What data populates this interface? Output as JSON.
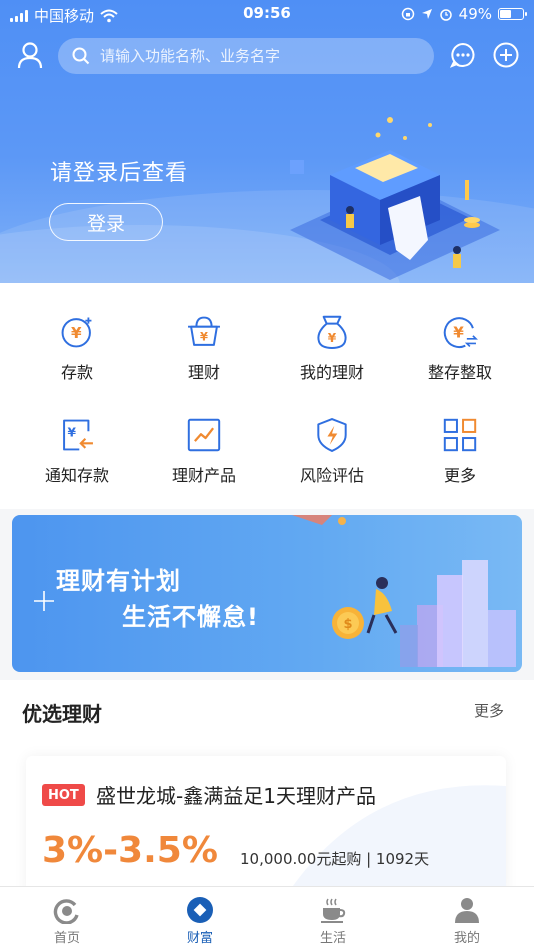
{
  "status_bar": {
    "carrier": "中国移动",
    "time": "09:56",
    "battery": "49%"
  },
  "search": {
    "placeholder": "请输入功能名称、业务名字"
  },
  "hero": {
    "prompt": "请登录后查看",
    "login_label": "登录"
  },
  "grid": [
    {
      "label": "存款",
      "icon": "deposit-icon"
    },
    {
      "label": "理财",
      "icon": "wealth-basket-icon"
    },
    {
      "label": "我的理财",
      "icon": "money-bag-icon"
    },
    {
      "label": "整存整取",
      "icon": "lump-sum-icon"
    },
    {
      "label": "通知存款",
      "icon": "notice-deposit-icon"
    },
    {
      "label": "理财产品",
      "icon": "chart-trend-icon"
    },
    {
      "label": "风险评估",
      "icon": "shield-bolt-icon"
    },
    {
      "label": "更多",
      "icon": "grid-more-icon"
    }
  ],
  "banner": {
    "line1": "理财有计划",
    "line2": "生活不懈怠!"
  },
  "featured": {
    "title": "优选理财",
    "more": "更多",
    "product": {
      "badge": "HOT",
      "name": "盛世龙城-鑫满益足1天理财产品",
      "rate": "3%-3.5%",
      "meta": "10,000.00元起购 | 1092天"
    }
  },
  "tabbar": [
    {
      "label": "首页",
      "icon": "home-icon",
      "active": false
    },
    {
      "label": "财富",
      "icon": "wealth-icon",
      "active": true
    },
    {
      "label": "生活",
      "icon": "coffee-icon",
      "active": false
    },
    {
      "label": "我的",
      "icon": "profile-icon",
      "active": false
    }
  ],
  "colors": {
    "primary": "#4f8ff5",
    "accent_orange": "#f0883b",
    "hot_red": "#ef4a48",
    "tab_active": "#1a5fb6"
  }
}
